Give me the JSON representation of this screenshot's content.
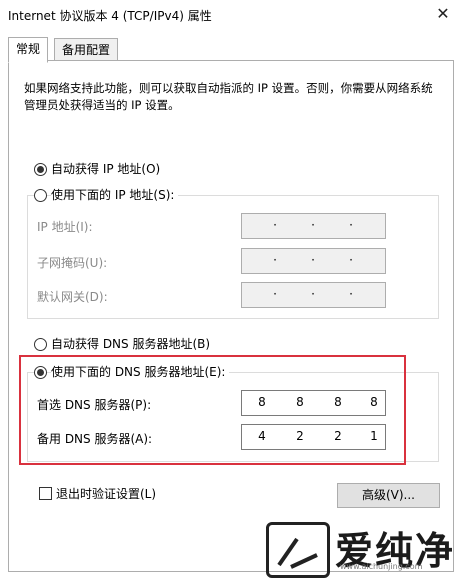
{
  "window": {
    "title": "Internet 协议版本 4 (TCP/IPv4) 属性",
    "close_symbol": "✕"
  },
  "tabs": [
    {
      "label": "常规",
      "active": true
    },
    {
      "label": "备用配置",
      "active": false
    }
  ],
  "description": "如果网络支持此功能，则可以获取自动指派的 IP 设置。否则，你需要从网络系统管理员处获得适当的 IP 设置。",
  "ip_section": {
    "auto_label": "自动获得 IP 地址(O)",
    "manual_label": "使用下面的 IP 地址(S):",
    "auto_checked": true,
    "fields": [
      {
        "label": "IP 地址(I):",
        "dots": [
          "·",
          "·",
          "·"
        ]
      },
      {
        "label": "子网掩码(U):",
        "dots": [
          "·",
          "·",
          "·"
        ]
      },
      {
        "label": "默认网关(D):",
        "dots": [
          "·",
          "·",
          "·"
        ]
      }
    ]
  },
  "dns_section": {
    "auto_label": "自动获得 DNS 服务器地址(B)",
    "manual_label": "使用下面的 DNS 服务器地址(E):",
    "manual_checked": true,
    "preferred_label": "首选 DNS 服务器(P):",
    "preferred": [
      "8",
      "8",
      "8",
      "8"
    ],
    "alternate_label": "备用 DNS 服务器(A):",
    "alternate": [
      "4",
      "2",
      "2",
      "1"
    ]
  },
  "validate_label": "退出时验证设置(L)",
  "advanced_label": "高级(V)...",
  "watermark": {
    "text": "爱纯净",
    "url": "www.aichunjing.com"
  }
}
